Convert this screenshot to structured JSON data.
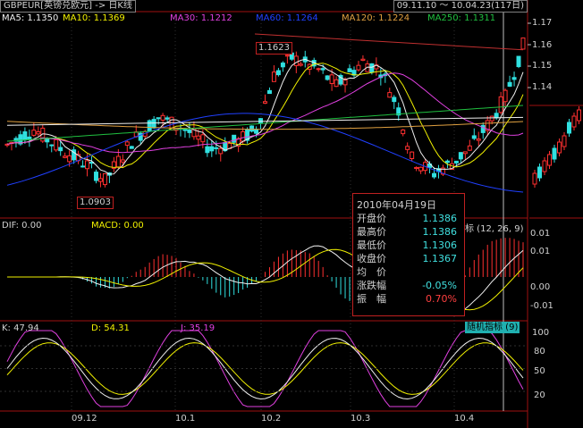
{
  "title": "GBPEUR[英镑兑欧元] -> 日K线",
  "period": "09.11.10 ～ 10.04.23(117日)",
  "ma_legend": [
    {
      "label": "MA5: 1.1350",
      "color": "#f0f0f0"
    },
    {
      "label": "MA10: 1.1369",
      "color": "#f0f000"
    },
    {
      "label": "MA30: 1.1212",
      "color": "#e040e0"
    },
    {
      "label": "MA60: 1.1264",
      "color": "#2040ff"
    },
    {
      "label": "MA120: 1.1224",
      "color": "#e0a040"
    },
    {
      "label": "MA250: 1.1311",
      "color": "#20c040"
    }
  ],
  "price_axis": [
    "1.17",
    "1.16",
    "1.15",
    "1.14"
  ],
  "high_marker": "1.1623",
  "low_marker": "1.0903",
  "info": {
    "date": "2010年04月19日",
    "rows": [
      {
        "k": "开盘价",
        "v": "1.1386",
        "color": "#40e0e0"
      },
      {
        "k": "最高价",
        "v": "1.1386",
        "color": "#40e0e0"
      },
      {
        "k": "最低价",
        "v": "1.1306",
        "color": "#40e0e0"
      },
      {
        "k": "收盘价",
        "v": "1.1367",
        "color": "#40e0e0"
      },
      {
        "k": "均　价",
        "v": "",
        "color": "#40e0e0"
      },
      {
        "k": "涨跌幅",
        "v": "-0.05%",
        "color": "#40e0e0"
      },
      {
        "k": "振　幅",
        "v": "0.70%",
        "color": "#ff4040"
      }
    ]
  },
  "macd": {
    "dif": "DIF: 0.00",
    "macd": "MACD: 0.00",
    "right_label": "标 (12, 26, 9)",
    "axis": [
      "0.01",
      "0.01",
      "0.00",
      "-0.01"
    ]
  },
  "kdj": {
    "k": "K: 47.94",
    "d": "D: 54.31",
    "j": "J: 35.19",
    "right_label": "随机指标 (9)",
    "axis": [
      "100",
      "80",
      "50",
      "20"
    ]
  },
  "x_axis": [
    "09.12",
    "10.1",
    "10.2",
    "10.3",
    "10.4"
  ],
  "chart_data": {
    "type": "candlestick",
    "title": "GBPEUR[英镑兑欧元] -> 日K线",
    "period": "09.11.10 ～ 10.04.23",
    "bars": 117,
    "price_range": [
      1.085,
      1.175
    ],
    "highest": 1.1623,
    "lowest": 1.0903,
    "selected_day": {
      "date": "2010-04-19",
      "open": 1.1386,
      "high": 1.1386,
      "low": 1.1306,
      "close": 1.1367,
      "change_pct": -0.05,
      "amplitude_pct": 0.7
    },
    "moving_averages": {
      "MA5": 1.135,
      "MA10": 1.1369,
      "MA30": 1.1212,
      "MA60": 1.1264,
      "MA120": 1.1224,
      "MA250": 1.1311
    },
    "macd": {
      "DIF": 0.0,
      "MACD": 0.0,
      "params": [
        12,
        26,
        9
      ]
    },
    "kdj": {
      "K": 47.94,
      "D": 54.31,
      "J": 35.19,
      "param": 9
    }
  }
}
